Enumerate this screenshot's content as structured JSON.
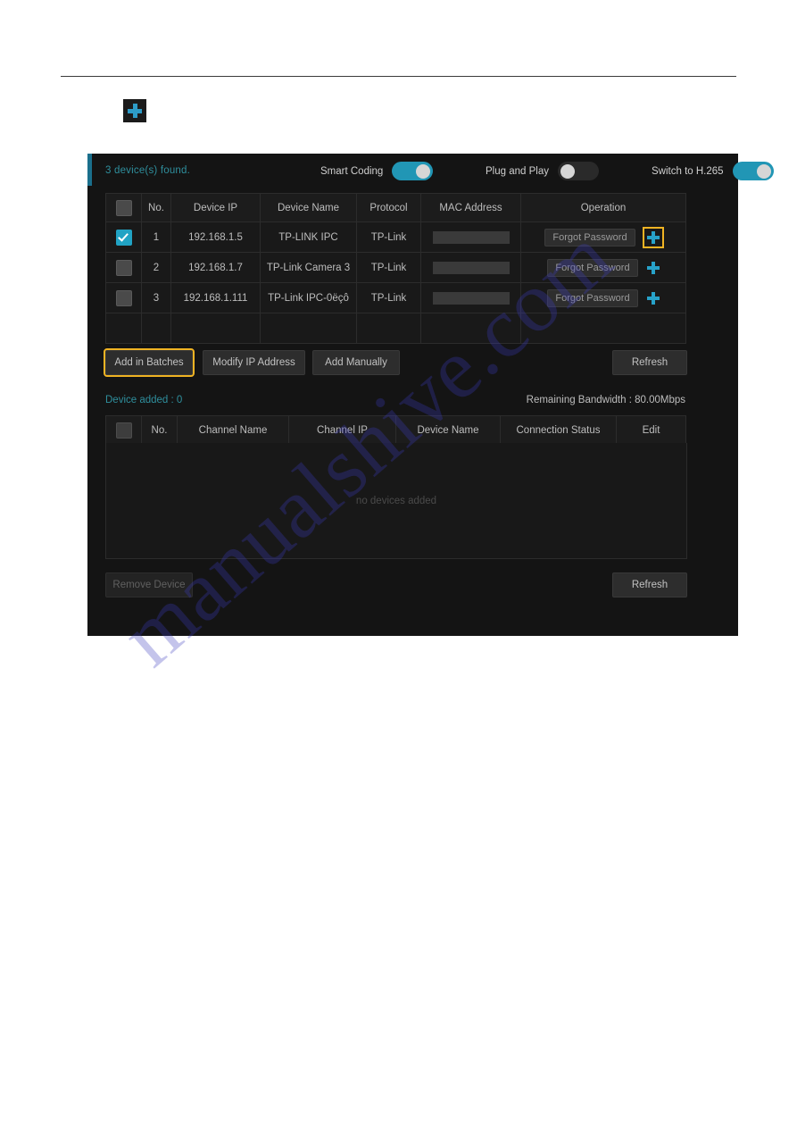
{
  "page": {
    "plus_badge_icon": "plus-icon"
  },
  "dialog": {
    "topbar": {
      "found_text": "3 device(s) found.",
      "toggles": [
        {
          "label": "Smart Coding",
          "state": "on"
        },
        {
          "label": "Plug and Play",
          "state": "off"
        },
        {
          "label": "Switch to H.265",
          "state": "on"
        }
      ]
    },
    "discovery_table": {
      "headers": [
        "",
        "No.",
        "Device IP",
        "Device Name",
        "Protocol",
        "MAC Address",
        "Operation"
      ],
      "rows": [
        {
          "checked": true,
          "no": "1",
          "device_ip": "192.168.1.5",
          "device_name": "TP-LINK IPC",
          "protocol": "TP-Link",
          "mac_address": "",
          "forgot_password_label": "Forgot Password",
          "add_icon": "plus-icon",
          "add_highlighted": true
        },
        {
          "checked": false,
          "no": "2",
          "device_ip": "192.168.1.7",
          "device_name": "TP-Link Camera 3",
          "protocol": "TP-Link",
          "mac_address": "",
          "forgot_password_label": "Forgot Password",
          "add_icon": "plus-icon",
          "add_highlighted": false
        },
        {
          "checked": false,
          "no": "3",
          "device_ip": "192.168.1.111",
          "device_name": "TP-Link IPC-0ëçô",
          "protocol": "TP-Link",
          "mac_address": "",
          "forgot_password_label": "Forgot Password",
          "add_icon": "plus-icon",
          "add_highlighted": false
        }
      ]
    },
    "action_buttons": {
      "add_in_batches": "Add in Batches",
      "modify_ip_address": "Modify IP Address",
      "add_manually": "Add Manually",
      "refresh": "Refresh"
    },
    "status": {
      "device_added": "Device added : 0",
      "remaining_bandwidth": "Remaining Bandwidth : 80.00Mbps"
    },
    "added_table": {
      "headers": [
        "",
        "No.",
        "Channel Name",
        "Channel IP",
        "Device Name",
        "Connection Status",
        "Edit"
      ],
      "empty_message": "no devices added"
    },
    "bottom_buttons": {
      "remove_device": "Remove Device",
      "refresh": "Refresh"
    }
  },
  "watermark": {
    "text": "manualshive.com"
  },
  "colors": {
    "accent_teal": "#1a6f8c",
    "toggle_on": "#2196b5",
    "plus_blue": "#27a2c9",
    "highlight_gold": "#f0b323",
    "status_teal": "#2f8f9d",
    "dialog_bg": "#141414"
  }
}
